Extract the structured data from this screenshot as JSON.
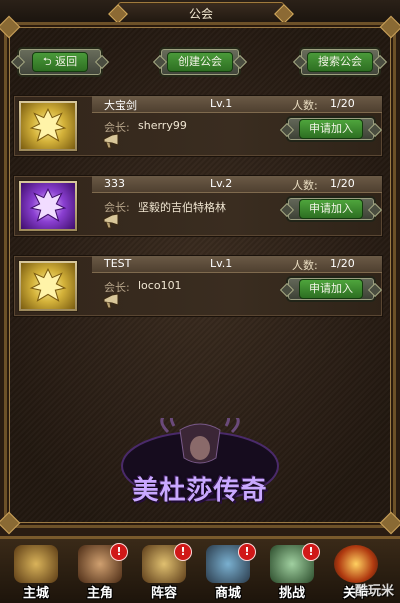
{
  "window": {
    "title": "公会"
  },
  "toolbar": {
    "back_label": "返回",
    "create_label": "创建公会",
    "search_label": "搜索公会"
  },
  "labels": {
    "member_count": "人数:",
    "leader": "会长:",
    "join": "申请加入"
  },
  "guilds": [
    {
      "name": "大宝剑",
      "level": "Lv.1",
      "members": "1/20",
      "leader": "sherry99",
      "emblem": "gold-dragon-emblem"
    },
    {
      "name": "333",
      "level": "Lv.2",
      "members": "1/20",
      "leader": "坚毅的吉伯特格林",
      "emblem": "purple-dragon-emblem"
    },
    {
      "name": "TEST",
      "level": "Lv.1",
      "members": "1/20",
      "leader": "loco101",
      "emblem": "gold-dragon-emblem"
    }
  ],
  "logo": {
    "text": "美杜莎传奇"
  },
  "bottom_nav": [
    {
      "label": "主城",
      "icon": "castle-icon",
      "alert": ""
    },
    {
      "label": "主角",
      "icon": "hero-icon",
      "alert": "!"
    },
    {
      "label": "阵容",
      "icon": "lineup-icon",
      "alert": "!"
    },
    {
      "label": "商城",
      "icon": "shop-icon",
      "alert": "!"
    },
    {
      "label": "挑战",
      "icon": "challenge-icon",
      "alert": "!"
    },
    {
      "label": "关卡",
      "icon": "stage-icon",
      "alert": ""
    }
  ],
  "watermark": "酷玩米",
  "colors": {
    "button_green": "#3f8a30",
    "panel_brown": "#2e2218",
    "frame_gold": "#9b7a45",
    "alert_red": "#d01818"
  }
}
